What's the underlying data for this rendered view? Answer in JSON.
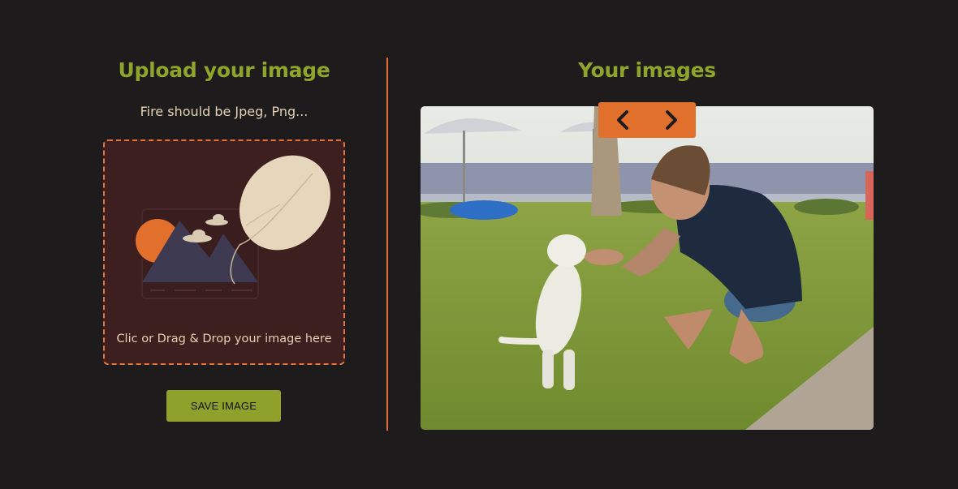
{
  "upload": {
    "title": "Upload your image",
    "hint": "Fire should be Jpeg, Png...",
    "dropzone_label": "Clic or Drag & Drop your image here",
    "save_label": "SAVE IMAGE"
  },
  "gallery": {
    "title": "Your images",
    "prev_icon": "chevron-left-icon",
    "next_icon": "chevron-right-icon"
  },
  "colors": {
    "background": "#1d1b1c",
    "accent_green": "#8fa42b",
    "accent_orange": "#e1702d",
    "dropzone_bg": "#3e1f1f",
    "text_cream": "#e3d2b4"
  }
}
